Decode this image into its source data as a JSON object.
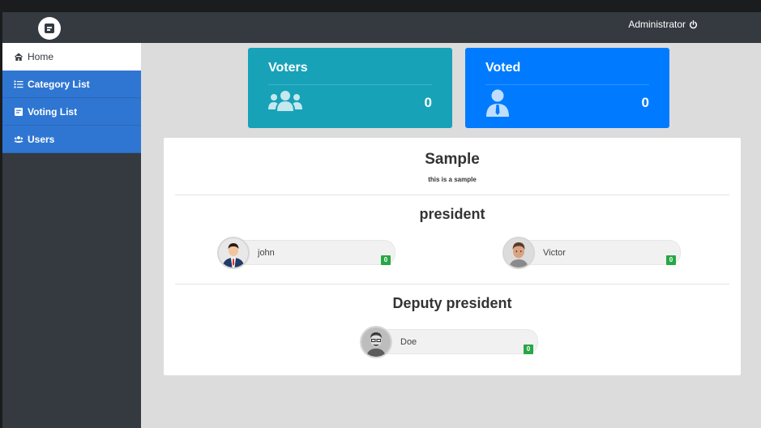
{
  "header": {
    "user_label": "Administrator"
  },
  "sidebar": {
    "items": [
      {
        "label": "Home",
        "icon": "home-icon"
      },
      {
        "label": "Category List",
        "icon": "list-icon"
      },
      {
        "label": "Voting List",
        "icon": "voting-icon"
      },
      {
        "label": "Users",
        "icon": "users-icon"
      }
    ]
  },
  "cards": {
    "voters": {
      "title": "Voters",
      "count": "0",
      "color": "#17a2b8"
    },
    "voted": {
      "title": "Voted",
      "count": "0",
      "color": "#007bff"
    }
  },
  "election": {
    "title": "Sample",
    "description": "this is a sample",
    "categories": [
      {
        "name": "president",
        "candidates": [
          {
            "name": "john",
            "votes": "0"
          },
          {
            "name": "Victor",
            "votes": "0"
          }
        ]
      },
      {
        "name": "Deputy president",
        "candidates": [
          {
            "name": "Doe",
            "votes": "0"
          }
        ]
      }
    ]
  }
}
